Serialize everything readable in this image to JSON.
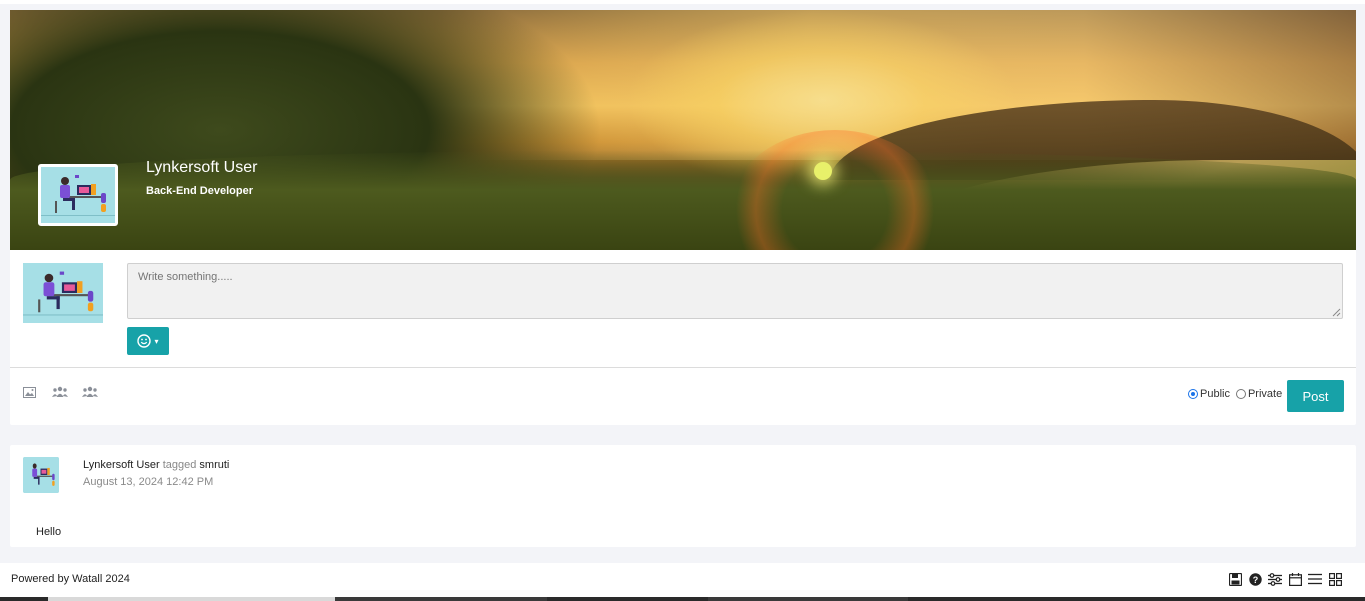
{
  "profile": {
    "name": "Lynkersoft User",
    "role": "Back-End Developer"
  },
  "composer": {
    "placeholder": "Write something.....",
    "emoji_caret": "▾",
    "visibility": {
      "public_label": "Public",
      "private_label": "Private",
      "selected": "Public"
    },
    "post_label": "Post",
    "tools": [
      "image-icon",
      "group-icon",
      "group-icon"
    ]
  },
  "feed": [
    {
      "author": "Lynkersoft User",
      "tagged_word": "tagged",
      "tagged_user": "smruti",
      "timestamp": "August 13, 2024 12:42 PM",
      "text": "Hello"
    }
  ],
  "footer": {
    "text": "Powered by Watall 2024",
    "icons": [
      "save-icon",
      "help-icon",
      "sliders-icon",
      "calendar-icon",
      "list-icon",
      "grid-icon"
    ]
  },
  "colors": {
    "accent": "#17a2a8",
    "background": "#f3f4f8",
    "avatar_bg": "#a6dfe6"
  }
}
